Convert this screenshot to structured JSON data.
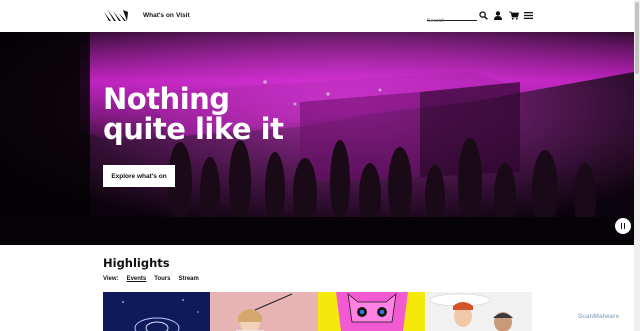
{
  "header": {
    "logo_icon": "opera-house-logo-icon",
    "nav": [
      {
        "label": "What's on"
      },
      {
        "label": "Visit"
      }
    ],
    "search": {
      "placeholder": "Search",
      "value": ""
    },
    "icons": [
      "search-icon",
      "account-icon",
      "cart-icon",
      "menu-icon"
    ]
  },
  "hero": {
    "title": "Nothing\nquite like it",
    "cta_label": "Explore what's on",
    "pause_icon": "pause-icon"
  },
  "highlights": {
    "title": "Highlights",
    "view_label": "View:",
    "tabs": [
      {
        "label": "Events",
        "active": true
      },
      {
        "label": "Tours",
        "active": false
      },
      {
        "label": "Stream",
        "active": false
      }
    ],
    "tiles": [
      {
        "color": "#0f1a5a"
      },
      {
        "color": "#e8b3b3"
      },
      {
        "color": "#f5e80b"
      },
      {
        "color": "#f1f1f1"
      }
    ]
  },
  "watermark": "ScanMalware",
  "colors": {
    "hero_accent": "#c018c0",
    "hero_dark": "#0c040c",
    "text": "#111111"
  }
}
